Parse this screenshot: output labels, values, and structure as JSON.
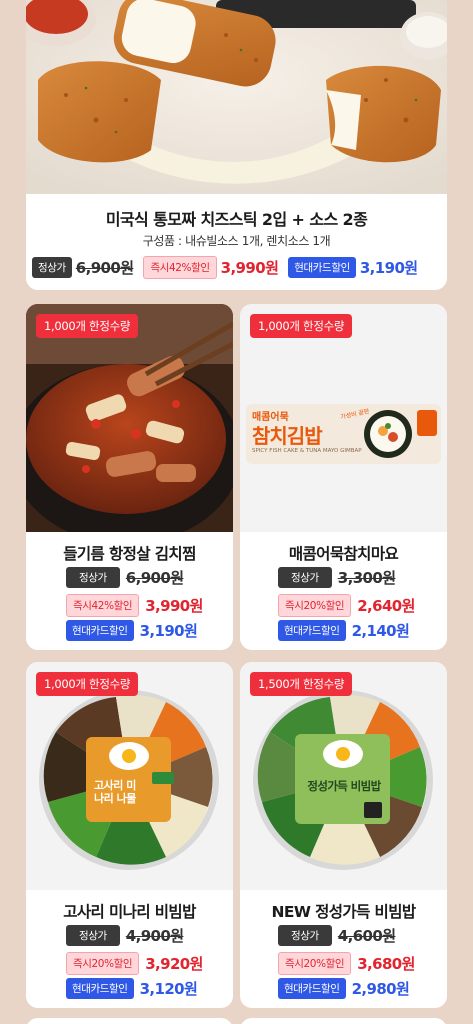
{
  "featured": {
    "title": "미국식 통모짜 치즈스틱 2입 + 소스 2종",
    "components": "구성품 : 내슈빌소스 1개, 렌치소스 1개",
    "regular_label": "정상가",
    "regular_price": "6,900원",
    "discount_label": "즉시42%할인",
    "discount_price": "3,990원",
    "card_label": "현대카드할인",
    "card_price": "3,190원"
  },
  "products": [
    {
      "badge": "1,000개 한정수량",
      "title": "들기름 항정살 김치찜",
      "regular_label": "정상가",
      "regular_price": "6,900원",
      "discount_label": "즉시42%할인",
      "discount_price": "3,990원",
      "card_label": "현대카드할인",
      "card_price": "3,190원"
    },
    {
      "badge": "1,000개 한정수량",
      "title": "매콤어묵참치마요",
      "pack_brand": "매콤어묵",
      "pack_name": "참치김밥",
      "pack_en": "SPICY FISH CAKE & TUNA MAYO GIMBAP",
      "pack_tag": "가성비 끝판",
      "regular_label": "정상가",
      "regular_price": "3,300원",
      "discount_label": "즉시20%할인",
      "discount_price": "2,640원",
      "card_label": "현대카드할인",
      "card_price": "2,140원"
    },
    {
      "badge": "1,000개 한정수량",
      "title": "고사리 미나리 비빔밥",
      "lid_text": "고사리 미나리 나물",
      "regular_label": "정상가",
      "regular_price": "4,900원",
      "discount_label": "즉시20%할인",
      "discount_price": "3,920원",
      "card_label": "현대카드할인",
      "card_price": "3,120원"
    },
    {
      "badge": "1,500개 한정수량",
      "title": "NEW 정성가득 비빔밥",
      "lid_text": "정성가득 비빔밥",
      "regular_label": "정상가",
      "regular_price": "4,600원",
      "discount_label": "즉시20%할인",
      "discount_price": "3,680원",
      "card_label": "현대카드할인",
      "card_price": "2,980원"
    }
  ]
}
